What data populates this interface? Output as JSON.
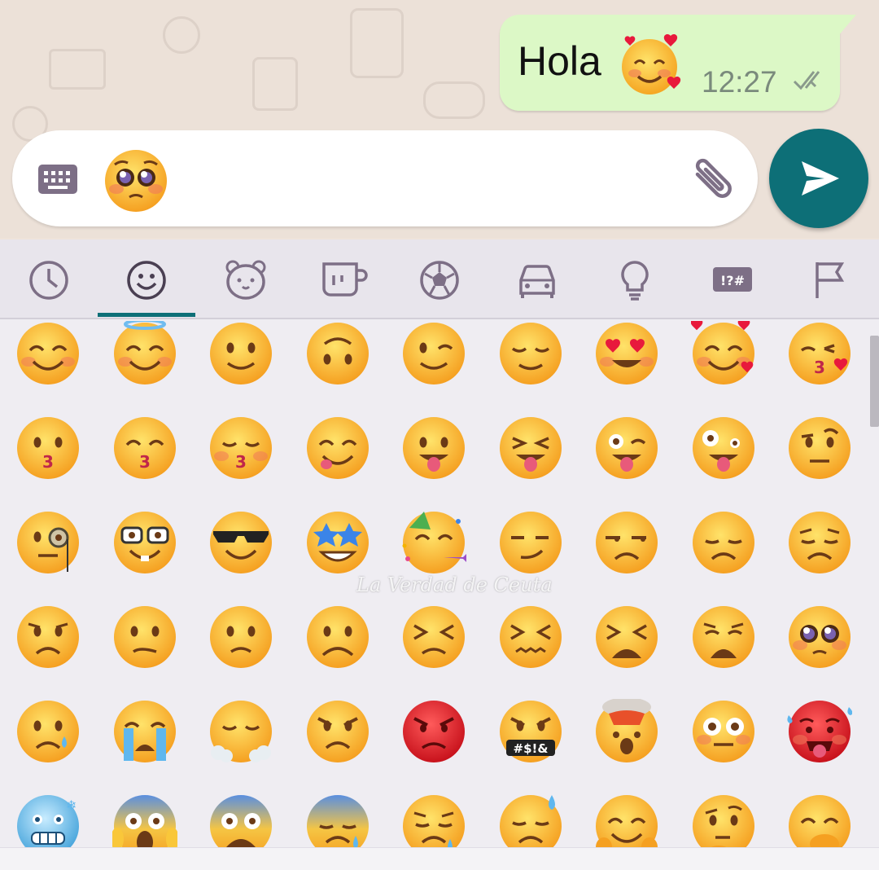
{
  "chat": {
    "message_text": "Hola",
    "message_emoji": "smiling-face-with-hearts",
    "message_time": "12:27",
    "message_status": "read-double-check"
  },
  "input": {
    "typed_emoji": "pleading-face",
    "keyboard_toggle": "keyboard-icon",
    "attach": "paperclip-icon",
    "send": "send-icon"
  },
  "tabs": [
    {
      "name": "recent",
      "icon": "clock-icon"
    },
    {
      "name": "smileys",
      "icon": "smiley-icon",
      "selected": true
    },
    {
      "name": "animals",
      "icon": "bear-icon"
    },
    {
      "name": "food",
      "icon": "cup-icon"
    },
    {
      "name": "activities",
      "icon": "soccer-ball-icon"
    },
    {
      "name": "travel",
      "icon": "car-icon"
    },
    {
      "name": "objects",
      "icon": "lightbulb-icon"
    },
    {
      "name": "symbols",
      "icon": "symbols-icon",
      "label": "!?#"
    },
    {
      "name": "flags",
      "icon": "flag-icon"
    }
  ],
  "emoji_rows": [
    [
      "smiling-eyes",
      "halo",
      "slight-smile",
      "upside-down",
      "wink",
      "relieved",
      "heart-eyes",
      "smiling-hearts",
      "kissing-heart"
    ],
    [
      "kissing",
      "kissing-smiling-eyes",
      "kissing-closed-eyes",
      "yum",
      "tongue",
      "squinting-tongue",
      "winking-tongue",
      "zany",
      "raised-eyebrow"
    ],
    [
      "monocle",
      "nerd",
      "sunglasses",
      "star-struck",
      "partying",
      "smirk",
      "unamused",
      "pensive",
      "disappointed"
    ],
    [
      "worried",
      "confused",
      "slight-frown",
      "frown",
      "persevering",
      "confounded",
      "tired",
      "weary",
      "pleading"
    ],
    [
      "sad-tear",
      "loudly-crying",
      "steam-nose",
      "angry",
      "pouting",
      "cursing",
      "exploding-head",
      "flushed",
      "hot"
    ],
    [
      "cold",
      "screaming",
      "fearful",
      "anxious-sweat",
      "sad-relieved",
      "downcast-sweat",
      "hugging",
      "thinking",
      "hand-over-mouth"
    ]
  ],
  "cursing_symbols": "#$!&",
  "watermark": "La Verdad de Ceuta",
  "colors": {
    "accent": "#0d6f77",
    "bubble": "#dcf8c6",
    "emoji_yellow": "#f9c73a",
    "emoji_red": "#e0202a"
  }
}
